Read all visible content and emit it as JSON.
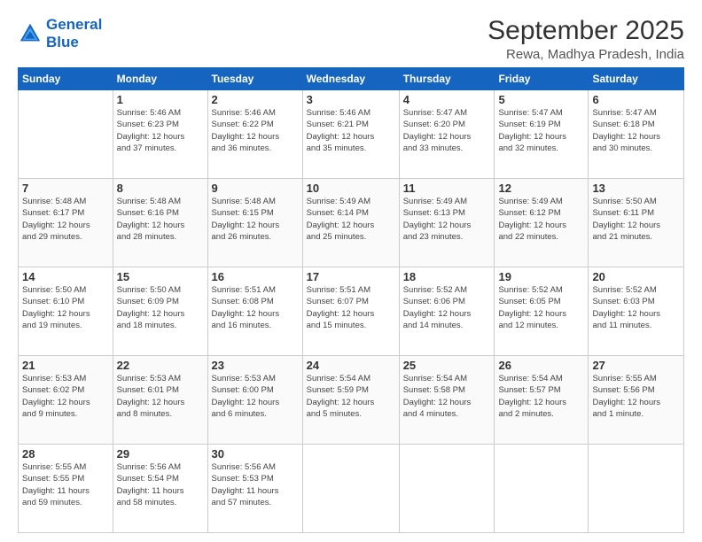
{
  "header": {
    "logo_line1": "General",
    "logo_line2": "Blue",
    "title": "September 2025",
    "subtitle": "Rewa, Madhya Pradesh, India"
  },
  "days_of_week": [
    "Sunday",
    "Monday",
    "Tuesday",
    "Wednesday",
    "Thursday",
    "Friday",
    "Saturday"
  ],
  "weeks": [
    [
      {
        "day": "",
        "info": ""
      },
      {
        "day": "1",
        "info": "Sunrise: 5:46 AM\nSunset: 6:23 PM\nDaylight: 12 hours\nand 37 minutes."
      },
      {
        "day": "2",
        "info": "Sunrise: 5:46 AM\nSunset: 6:22 PM\nDaylight: 12 hours\nand 36 minutes."
      },
      {
        "day": "3",
        "info": "Sunrise: 5:46 AM\nSunset: 6:21 PM\nDaylight: 12 hours\nand 35 minutes."
      },
      {
        "day": "4",
        "info": "Sunrise: 5:47 AM\nSunset: 6:20 PM\nDaylight: 12 hours\nand 33 minutes."
      },
      {
        "day": "5",
        "info": "Sunrise: 5:47 AM\nSunset: 6:19 PM\nDaylight: 12 hours\nand 32 minutes."
      },
      {
        "day": "6",
        "info": "Sunrise: 5:47 AM\nSunset: 6:18 PM\nDaylight: 12 hours\nand 30 minutes."
      }
    ],
    [
      {
        "day": "7",
        "info": "Sunrise: 5:48 AM\nSunset: 6:17 PM\nDaylight: 12 hours\nand 29 minutes."
      },
      {
        "day": "8",
        "info": "Sunrise: 5:48 AM\nSunset: 6:16 PM\nDaylight: 12 hours\nand 28 minutes."
      },
      {
        "day": "9",
        "info": "Sunrise: 5:48 AM\nSunset: 6:15 PM\nDaylight: 12 hours\nand 26 minutes."
      },
      {
        "day": "10",
        "info": "Sunrise: 5:49 AM\nSunset: 6:14 PM\nDaylight: 12 hours\nand 25 minutes."
      },
      {
        "day": "11",
        "info": "Sunrise: 5:49 AM\nSunset: 6:13 PM\nDaylight: 12 hours\nand 23 minutes."
      },
      {
        "day": "12",
        "info": "Sunrise: 5:49 AM\nSunset: 6:12 PM\nDaylight: 12 hours\nand 22 minutes."
      },
      {
        "day": "13",
        "info": "Sunrise: 5:50 AM\nSunset: 6:11 PM\nDaylight: 12 hours\nand 21 minutes."
      }
    ],
    [
      {
        "day": "14",
        "info": "Sunrise: 5:50 AM\nSunset: 6:10 PM\nDaylight: 12 hours\nand 19 minutes."
      },
      {
        "day": "15",
        "info": "Sunrise: 5:50 AM\nSunset: 6:09 PM\nDaylight: 12 hours\nand 18 minutes."
      },
      {
        "day": "16",
        "info": "Sunrise: 5:51 AM\nSunset: 6:08 PM\nDaylight: 12 hours\nand 16 minutes."
      },
      {
        "day": "17",
        "info": "Sunrise: 5:51 AM\nSunset: 6:07 PM\nDaylight: 12 hours\nand 15 minutes."
      },
      {
        "day": "18",
        "info": "Sunrise: 5:52 AM\nSunset: 6:06 PM\nDaylight: 12 hours\nand 14 minutes."
      },
      {
        "day": "19",
        "info": "Sunrise: 5:52 AM\nSunset: 6:05 PM\nDaylight: 12 hours\nand 12 minutes."
      },
      {
        "day": "20",
        "info": "Sunrise: 5:52 AM\nSunset: 6:03 PM\nDaylight: 12 hours\nand 11 minutes."
      }
    ],
    [
      {
        "day": "21",
        "info": "Sunrise: 5:53 AM\nSunset: 6:02 PM\nDaylight: 12 hours\nand 9 minutes."
      },
      {
        "day": "22",
        "info": "Sunrise: 5:53 AM\nSunset: 6:01 PM\nDaylight: 12 hours\nand 8 minutes."
      },
      {
        "day": "23",
        "info": "Sunrise: 5:53 AM\nSunset: 6:00 PM\nDaylight: 12 hours\nand 6 minutes."
      },
      {
        "day": "24",
        "info": "Sunrise: 5:54 AM\nSunset: 5:59 PM\nDaylight: 12 hours\nand 5 minutes."
      },
      {
        "day": "25",
        "info": "Sunrise: 5:54 AM\nSunset: 5:58 PM\nDaylight: 12 hours\nand 4 minutes."
      },
      {
        "day": "26",
        "info": "Sunrise: 5:54 AM\nSunset: 5:57 PM\nDaylight: 12 hours\nand 2 minutes."
      },
      {
        "day": "27",
        "info": "Sunrise: 5:55 AM\nSunset: 5:56 PM\nDaylight: 12 hours\nand 1 minute."
      }
    ],
    [
      {
        "day": "28",
        "info": "Sunrise: 5:55 AM\nSunset: 5:55 PM\nDaylight: 11 hours\nand 59 minutes."
      },
      {
        "day": "29",
        "info": "Sunrise: 5:56 AM\nSunset: 5:54 PM\nDaylight: 11 hours\nand 58 minutes."
      },
      {
        "day": "30",
        "info": "Sunrise: 5:56 AM\nSunset: 5:53 PM\nDaylight: 11 hours\nand 57 minutes."
      },
      {
        "day": "",
        "info": ""
      },
      {
        "day": "",
        "info": ""
      },
      {
        "day": "",
        "info": ""
      },
      {
        "day": "",
        "info": ""
      }
    ]
  ]
}
